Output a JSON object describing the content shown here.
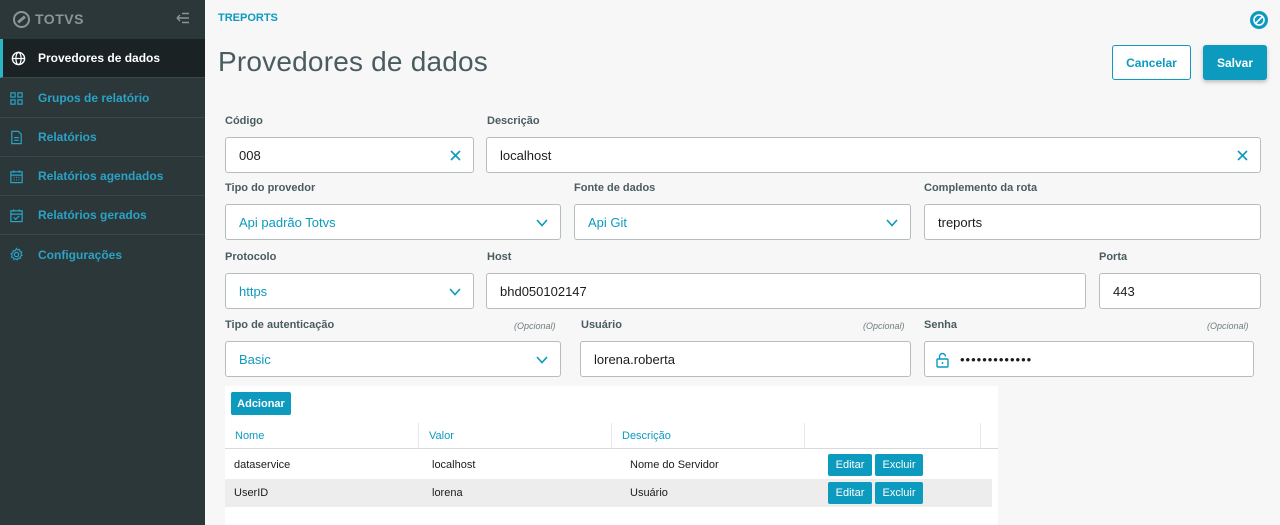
{
  "sidebar": {
    "brand": "TOTVS",
    "items": [
      {
        "label": "Provedores de dados",
        "icon": "globe-icon"
      },
      {
        "label": "Grupos de relatório",
        "icon": "grid-icon"
      },
      {
        "label": "Relatórios",
        "icon": "document-icon"
      },
      {
        "label": "Relatórios agendados",
        "icon": "calendar-icon"
      },
      {
        "label": "Relatórios gerados",
        "icon": "calendar-check-icon"
      },
      {
        "label": "Configurações",
        "icon": "gear-icon"
      }
    ]
  },
  "header": {
    "breadcrumb": "TREPORTS",
    "title": "Provedores de dados",
    "cancel_label": "Cancelar",
    "save_label": "Salvar"
  },
  "form": {
    "codigo": {
      "label": "Código",
      "value": "008"
    },
    "descricao": {
      "label": "Descrição",
      "value": "localhost"
    },
    "tipo_provedor": {
      "label": "Tipo do provedor",
      "value": "Api padrão Totvs"
    },
    "fonte_dados": {
      "label": "Fonte de dados",
      "value": "Api Git"
    },
    "complemento_rota": {
      "label": "Complemento da rota",
      "value": "treports"
    },
    "protocolo": {
      "label": "Protocolo",
      "value": "https"
    },
    "host": {
      "label": "Host",
      "value": "bhd050102147"
    },
    "porta": {
      "label": "Porta",
      "value": "443"
    },
    "tipo_autenticacao": {
      "label": "Tipo de autenticação",
      "optional": "(Opcional)",
      "value": "Basic"
    },
    "usuario": {
      "label": "Usuário",
      "optional": "(Opcional)",
      "value": "lorena.roberta"
    },
    "senha": {
      "label": "Senha",
      "optional": "(Opcional)",
      "value": "•••••••••••••"
    }
  },
  "table": {
    "add_label": "Adcionar",
    "columns": [
      "Nome",
      "Valor",
      "Descrição"
    ],
    "edit_label": "Editar",
    "delete_label": "Excluir",
    "rows": [
      {
        "nome": "dataservice",
        "valor": "localhost",
        "descricao": "Nome do Servidor"
      },
      {
        "nome": "UserID",
        "valor": "lorena",
        "descricao": "Usuário"
      }
    ]
  },
  "colors": {
    "accent": "#0c9abe",
    "sidebar_bg": "#2c3739",
    "sidebar_active": "#1a2224"
  }
}
